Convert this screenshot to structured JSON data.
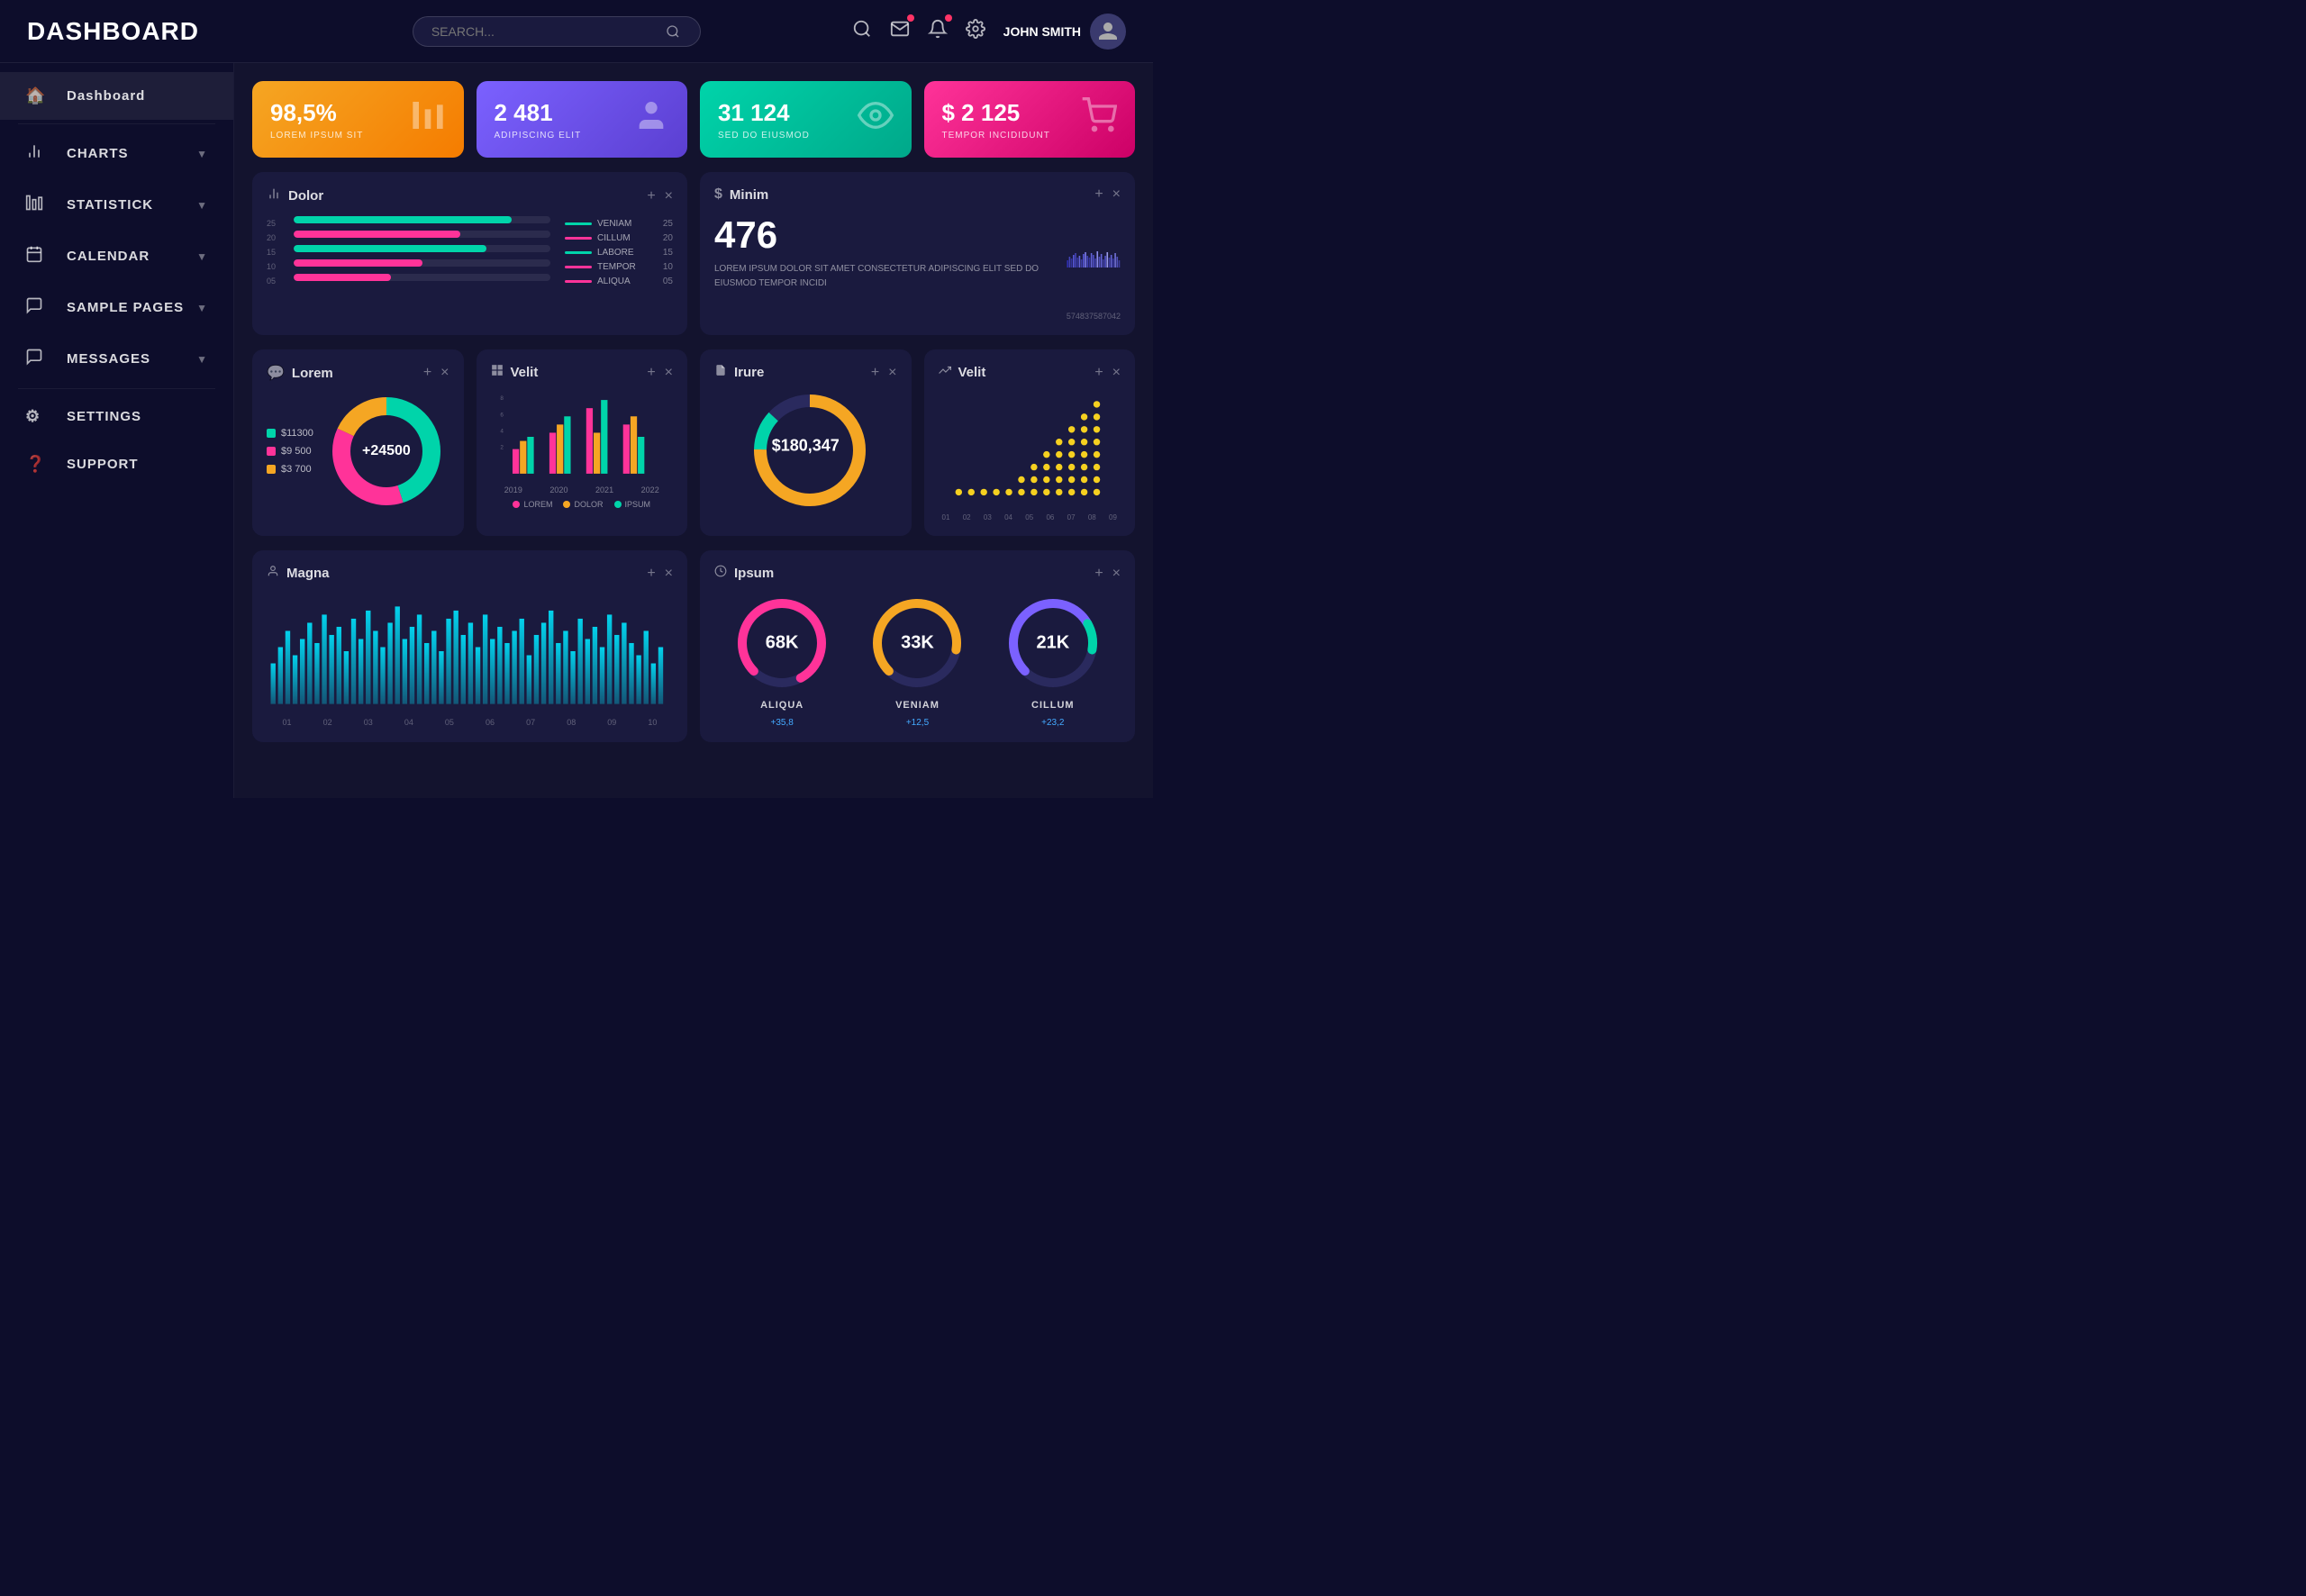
{
  "header": {
    "title": "DASHBOARD",
    "search_placeholder": "SEARCH...",
    "user_name": "JOHN SMITH"
  },
  "sidebar": {
    "items": [
      {
        "id": "dashboard",
        "label": "Dashboard",
        "icon": "🏠",
        "active": true,
        "has_chevron": false
      },
      {
        "id": "charts",
        "label": "CHARTS",
        "icon": "📊",
        "active": false,
        "has_chevron": true
      },
      {
        "id": "statistick",
        "label": "STATISTICK",
        "icon": "📈",
        "active": false,
        "has_chevron": true
      },
      {
        "id": "calendar",
        "label": "CALENDAR",
        "icon": "📅",
        "active": false,
        "has_chevron": true
      },
      {
        "id": "sample-pages",
        "label": "SAMPLE PAGES",
        "icon": "💬",
        "active": false,
        "has_chevron": true
      },
      {
        "id": "messages",
        "label": "MESSAGES",
        "icon": "🗨",
        "active": false,
        "has_chevron": true
      },
      {
        "id": "settings",
        "label": "SETTINGS",
        "icon": "⚙",
        "active": false,
        "has_chevron": false
      },
      {
        "id": "support",
        "label": "SUPPORT",
        "icon": "❓",
        "active": false,
        "has_chevron": false
      }
    ]
  },
  "stat_cards": [
    {
      "id": "card1",
      "value": "98,5%",
      "label": "LOREM IPSUM SIT",
      "color": "stat-card-1",
      "icon": "📊"
    },
    {
      "id": "card2",
      "value": "2 481",
      "label": "ADIPISCING ELIT",
      "color": "stat-card-2",
      "icon": "👤"
    },
    {
      "id": "card3",
      "value": "31 124",
      "label": "SED DO EIUSMOD",
      "color": "stat-card-3",
      "icon": "👁"
    },
    {
      "id": "card4",
      "value": "$ 2 125",
      "label": "TEMPOR INCIDIDUNT",
      "color": "stat-card-4",
      "icon": "🛒"
    }
  ],
  "dolor_card": {
    "title": "Dolor",
    "bars": [
      {
        "label": "25",
        "width": 85,
        "color": "#00d4aa",
        "legend": "VENIAM"
      },
      {
        "label": "20",
        "width": 65,
        "color": "#ff3399",
        "legend": "CILLUM"
      },
      {
        "label": "15",
        "width": 75,
        "color": "#00d4aa",
        "legend": "LABORE"
      },
      {
        "label": "10",
        "width": 50,
        "color": "#ff3399",
        "legend": "TEMPOR"
      },
      {
        "label": "05",
        "width": 40,
        "color": "#ff3399",
        "legend": "ALIQUA"
      }
    ],
    "y_labels": [
      "25",
      "20",
      "15",
      "10",
      "05"
    ],
    "legend_values": [
      "25",
      "20",
      "15",
      "10",
      "05"
    ]
  },
  "minim_card": {
    "title": "Minim",
    "value": "476",
    "description": "LOREM IPSUM DOLOR SIT AMET CONSECTETUR ADIPISCING ELIT SED DO EIUSMOD TEMPOR INCIDI",
    "x_labels": [
      "5748",
      "3758",
      "7042"
    ]
  },
  "lorem_card": {
    "title": "Lorem",
    "center_text": "+24500",
    "legend": [
      {
        "color": "#00d4aa",
        "label": "$11300"
      },
      {
        "color": "#ff3399",
        "label": "$9 500"
      },
      {
        "color": "#f5a623",
        "label": "$3 700"
      }
    ]
  },
  "velit_card": {
    "title": "Velit",
    "x_labels": [
      "2019",
      "2020",
      "2021",
      "2022"
    ],
    "legend": [
      "LOREM",
      "DOLOR",
      "IPSUM"
    ]
  },
  "irure_card": {
    "title": "Irure",
    "value": "$180,347"
  },
  "velit2_card": {
    "title": "Velit",
    "x_labels": [
      "01",
      "02",
      "03",
      "04",
      "05",
      "06",
      "07",
      "08",
      "09"
    ]
  },
  "magna_card": {
    "title": "Magna",
    "x_labels": [
      "01",
      "02",
      "03",
      "04",
      "05",
      "06",
      "07",
      "08",
      "09",
      "10"
    ]
  },
  "ipsum_card": {
    "title": "Ipsum",
    "gauges": [
      {
        "value": "68K",
        "label": "ALIQUA",
        "sublabel": "+35,8",
        "color": "#ff3399"
      },
      {
        "value": "33K",
        "label": "VENIAM",
        "sublabel": "+12,5",
        "color": "#f5a623"
      },
      {
        "value": "21K",
        "label": "CILLUM",
        "sublabel": "+23,2",
        "color": "#7b61ff"
      }
    ]
  }
}
